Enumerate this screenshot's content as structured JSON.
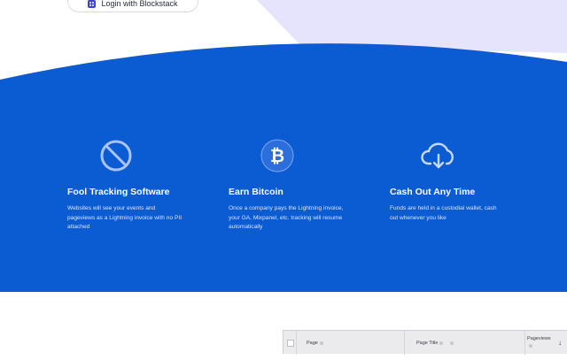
{
  "login": {
    "label": "Login with Blockstack",
    "icon": "blockstack-icon"
  },
  "colors": {
    "band": "#0b5bd3",
    "lavender": "#e6e4fd"
  },
  "features": [
    {
      "icon": "no-tracking-icon",
      "title": "Fool Tracking Software",
      "desc": "Websites will see your events and pageviews as a Lightning invoice with no PII attached"
    },
    {
      "icon": "bitcoin-icon",
      "title": "Earn Bitcoin",
      "desc": "Once a company pays the Lightning invoice, your GA, Mixpanel, etc. tracking will resume automatically"
    },
    {
      "icon": "cloud-download-icon",
      "title": "Cash Out Any Time",
      "desc": "Funds are held in a custodial wallet, cash out whenever you like"
    }
  ],
  "table": {
    "columns": [
      "Page",
      "Page Title",
      "Pageviews"
    ]
  }
}
